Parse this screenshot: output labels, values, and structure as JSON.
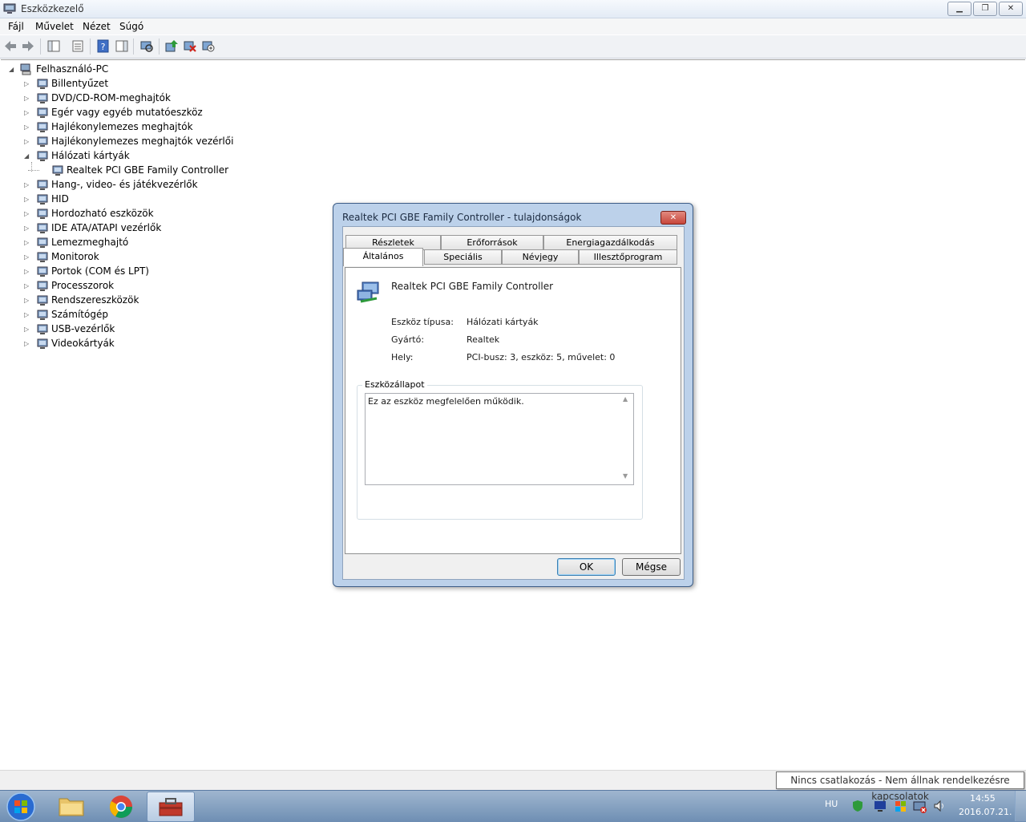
{
  "window": {
    "title": "Eszközkezelő"
  },
  "menu": [
    "Fájl",
    "Művelet",
    "Nézet",
    "Súgó"
  ],
  "tree": {
    "root": "Felhasználó-PC",
    "items": [
      {
        "label": "Billentyűzet",
        "icon": "keyboard-icon",
        "expanded": false
      },
      {
        "label": "DVD/CD-ROM-meghajtók",
        "icon": "dvd-drive-icon",
        "expanded": false
      },
      {
        "label": "Egér vagy egyéb mutatóeszköz",
        "icon": "mouse-icon",
        "expanded": false
      },
      {
        "label": "Hajlékonylemezes meghajtók",
        "icon": "floppy-drive-icon",
        "expanded": false
      },
      {
        "label": "Hajlékonylemezes meghajtók vezérlői",
        "icon": "floppy-controller-icon",
        "expanded": false
      },
      {
        "label": "Hálózati kártyák",
        "icon": "network-adapter-icon",
        "expanded": true
      },
      {
        "label": "Realtek PCI GBE Family Controller",
        "icon": "network-adapter-icon",
        "child": true
      },
      {
        "label": "Hang-, video- és játékvezérlők",
        "icon": "speaker-icon",
        "expanded": false
      },
      {
        "label": "HID",
        "icon": "hid-icon",
        "expanded": false
      },
      {
        "label": "Hordozható eszközök",
        "icon": "portable-device-icon",
        "expanded": false
      },
      {
        "label": "IDE ATA/ATAPI vezérlők",
        "icon": "ide-controller-icon",
        "expanded": false
      },
      {
        "label": "Lemezmeghajtó",
        "icon": "disk-drive-icon",
        "expanded": false
      },
      {
        "label": "Monitorok",
        "icon": "monitor-icon",
        "expanded": false
      },
      {
        "label": "Portok (COM és LPT)",
        "icon": "port-icon",
        "expanded": false
      },
      {
        "label": "Processzorok",
        "icon": "processor-icon",
        "expanded": false
      },
      {
        "label": "Rendszereszközök",
        "icon": "system-device-icon",
        "expanded": false
      },
      {
        "label": "Számítógép",
        "icon": "computer-icon",
        "expanded": false
      },
      {
        "label": "USB-vezérlők",
        "icon": "usb-icon",
        "expanded": false
      },
      {
        "label": "Videokártyák",
        "icon": "display-adapter-icon",
        "expanded": false
      }
    ]
  },
  "dialog": {
    "title": "Realtek PCI GBE Family Controller - tulajdonságok",
    "tabs_row1": [
      "Részletek",
      "Erőforrások",
      "Energiagazdálkodás"
    ],
    "tabs_row2": [
      "Általános",
      "Speciális",
      "Névjegy",
      "Illesztőprogram"
    ],
    "active_tab": "Általános",
    "device_name": "Realtek PCI GBE Family Controller",
    "props": [
      {
        "label": "Eszköz típusa:",
        "value": "Hálózati kártyák"
      },
      {
        "label": "Gyártó:",
        "value": "Realtek"
      },
      {
        "label": "Hely:",
        "value": "PCI-busz: 3, eszköz: 5, művelet: 0"
      }
    ],
    "status_group": "Eszközállapot",
    "status_text": "Ez az eszköz megfelelően működik.",
    "ok": "OK",
    "cancel": "Mégse"
  },
  "tooltip": "Nincs csatlakozás - Nem állnak rendelkezésre kapcsolatok",
  "tray": {
    "lang": "HU",
    "time": "14:55",
    "date": "2016.07.21."
  },
  "colors": {
    "accent": "#3d5d87",
    "close_red": "#c7463b"
  }
}
